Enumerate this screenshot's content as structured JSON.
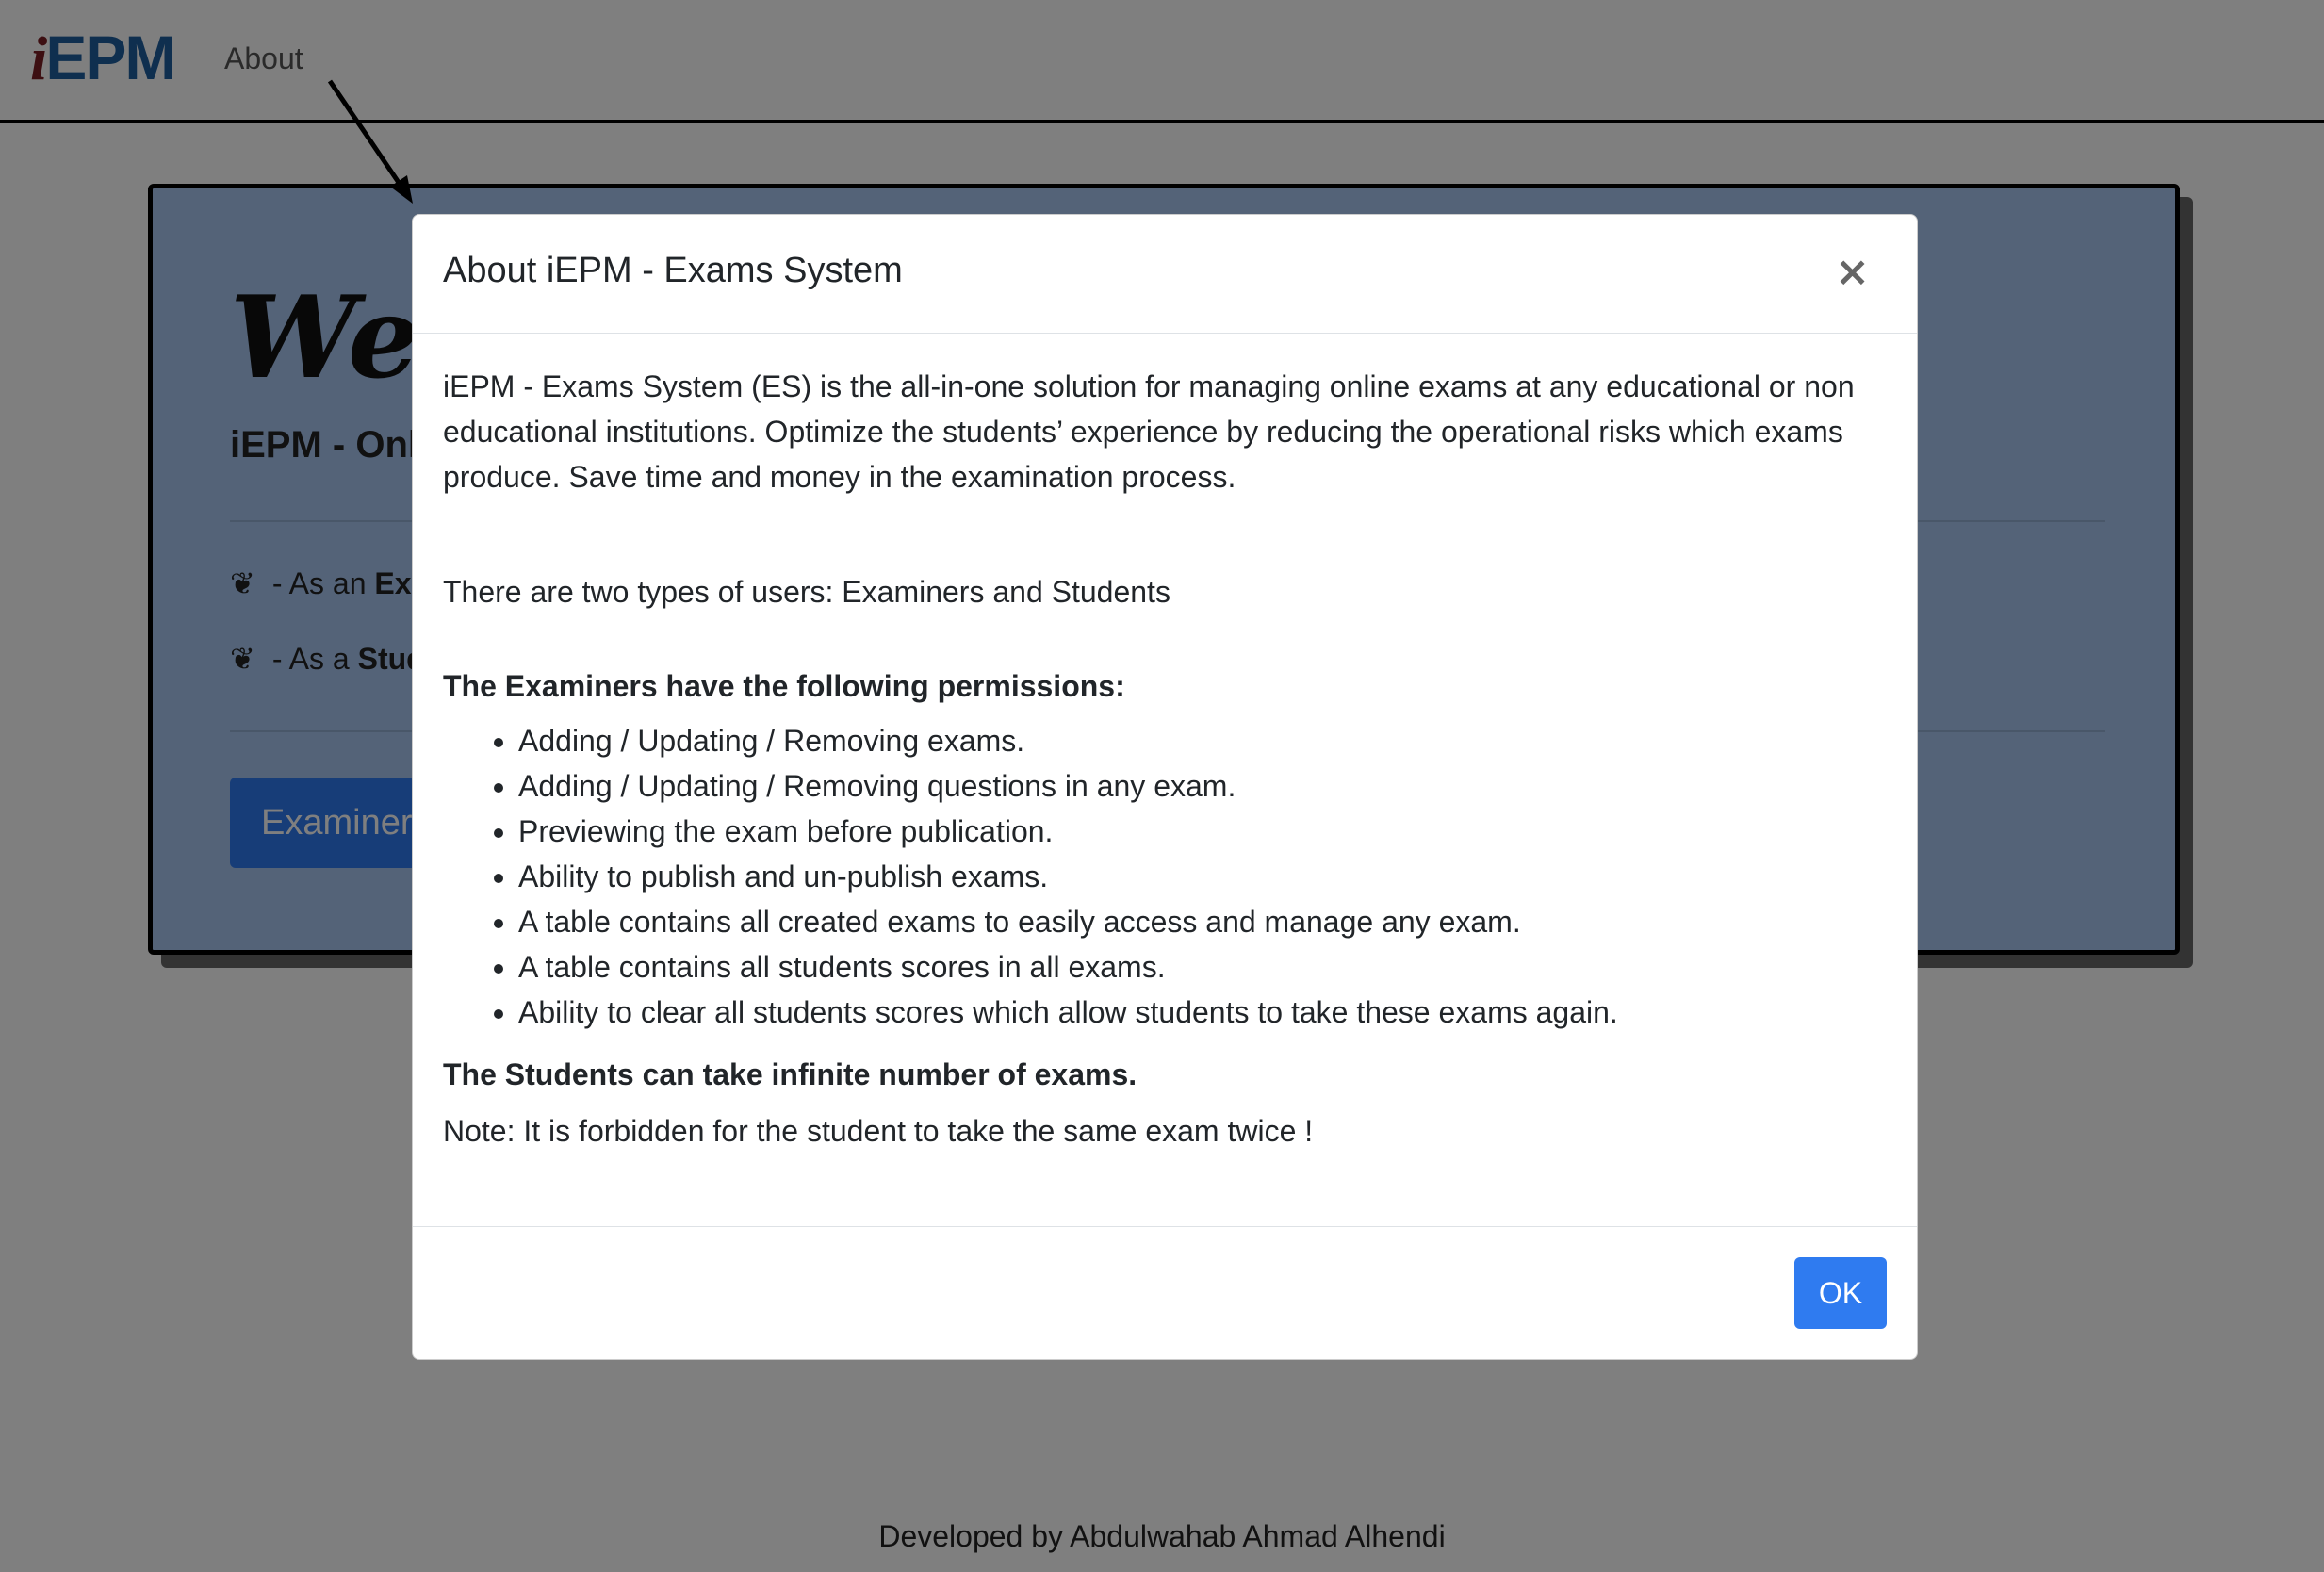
{
  "navbar": {
    "logo_i": "i",
    "logo_epm": "EPM",
    "about_link": "About"
  },
  "jumbotron": {
    "welcome_text": "Welcome",
    "subtitle": "iEPM - Online Exams System",
    "role_examiner_prefix": "- As an ",
    "role_examiner_bold": "Examiner",
    "role_student_prefix": "- As a ",
    "role_student_bold": "Student",
    "examiner_button": "Examiner"
  },
  "modal": {
    "title": "About iEPM - Exams System",
    "close_symbol": "×",
    "intro": "iEPM - Exams System (ES) is the all-in-one solution for managing online exams at any educational or non educational institutions. Optimize the students’ experience by reducing the operational risks which exams produce. Save time and money in the examination process.",
    "user_types": "There are two types of users: Examiners and Students",
    "examiners_heading": "The Examiners have the following permissions:",
    "examiner_permissions": [
      "Adding / Updating / Removing exams.",
      "Adding / Updating / Removing questions in any exam.",
      "Previewing the exam before publication.",
      "Ability to publish and un-publish exams.",
      "A table contains all created exams to easily access and manage any exam.",
      "A table contains all students scores in all exams.",
      "Ability to clear all students scores which allow students to take these exams again."
    ],
    "students_line": "The Students can take infinite number of exams.",
    "note": "Note: It is forbidden for the student to take the same exam twice !",
    "ok_button": "OK"
  },
  "footer": {
    "credit": "Developed by Abdulwahab Ahmad Alhendi"
  },
  "colors": {
    "primary": "#2f7bf0",
    "jumbotron_bg": "#a8c6f0",
    "logo_i": "#7a1f24",
    "logo_epm": "#1f5f9e"
  }
}
